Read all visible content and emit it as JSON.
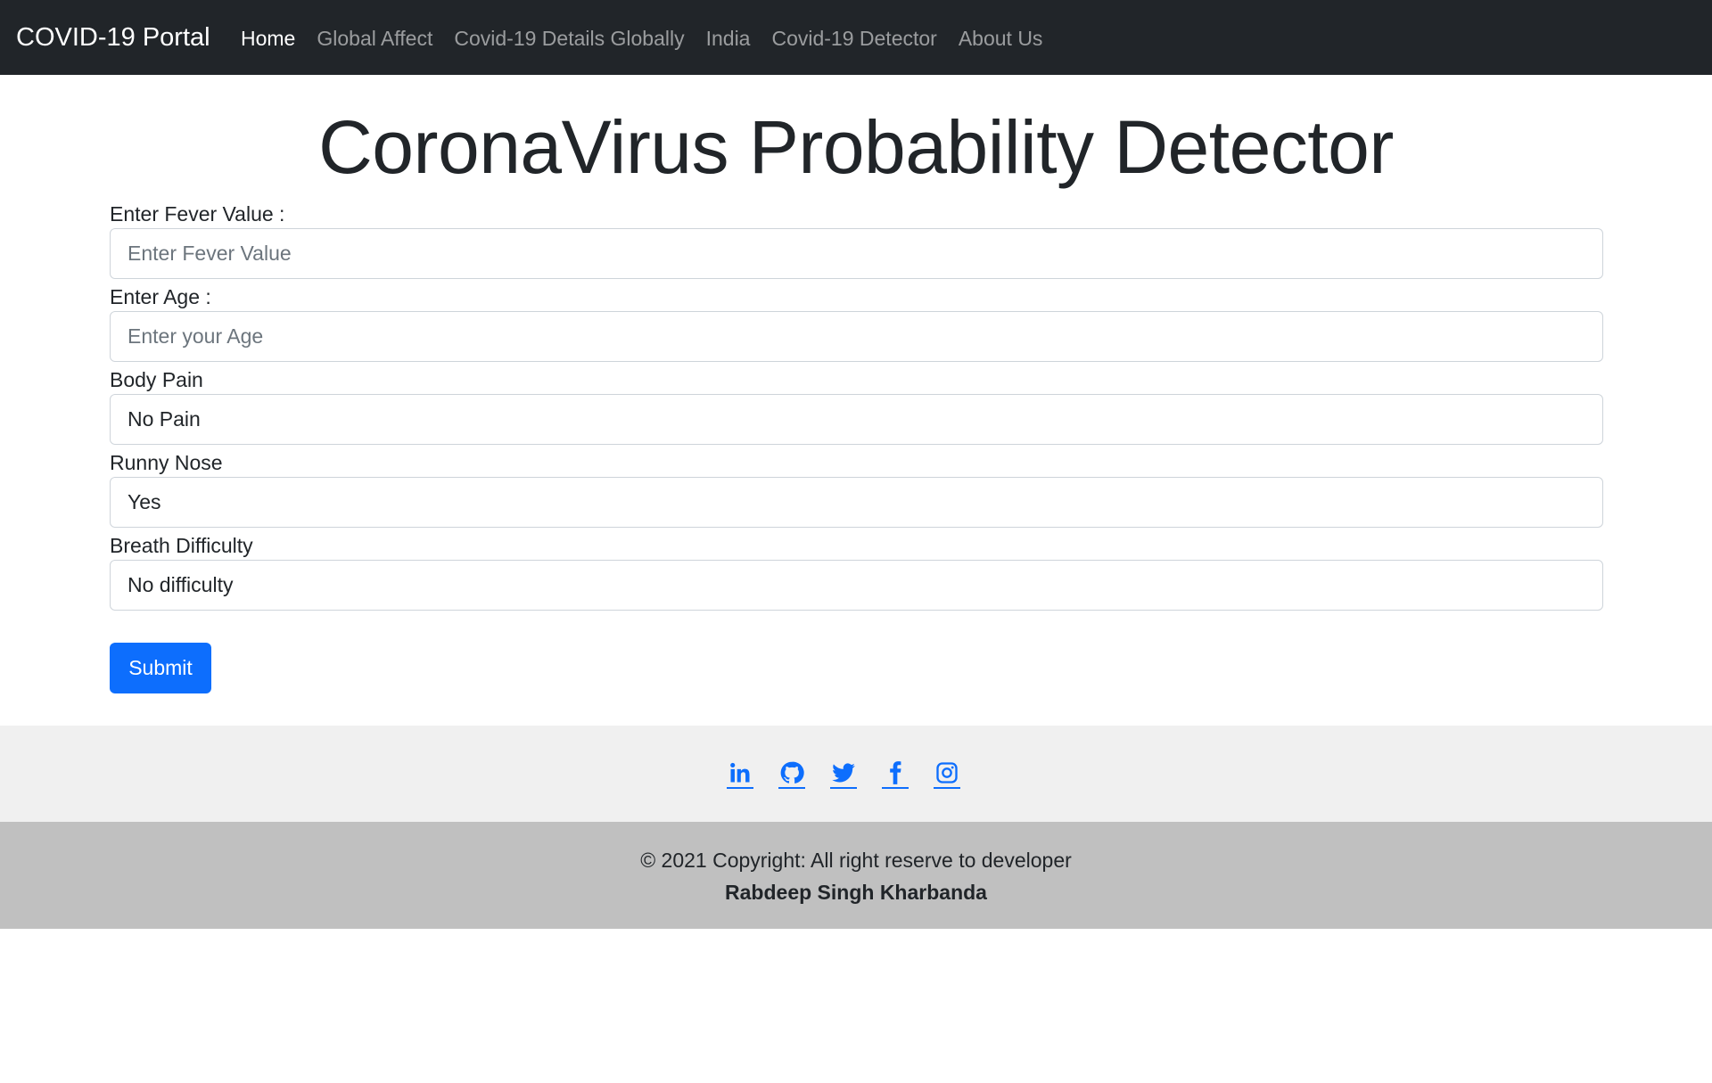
{
  "navbar": {
    "brand": "COVID-19 Portal",
    "links": [
      {
        "label": "Home",
        "active": true
      },
      {
        "label": "Global Affect",
        "active": false
      },
      {
        "label": "Covid-19 Details Globally",
        "active": false
      },
      {
        "label": "India",
        "active": false
      },
      {
        "label": "Covid-19 Detector",
        "active": false
      },
      {
        "label": "About Us",
        "active": false
      }
    ]
  },
  "page_title": "CoronaVirus Probability Detector",
  "form": {
    "fever": {
      "label": "Enter Fever Value :",
      "placeholder": "Enter Fever Value",
      "value": ""
    },
    "age": {
      "label": "Enter Age :",
      "placeholder": "Enter your Age",
      "value": ""
    },
    "body_pain": {
      "label": "Body Pain",
      "selected": "No Pain"
    },
    "runny_nose": {
      "label": "Runny Nose",
      "selected": "Yes"
    },
    "breath_difficulty": {
      "label": "Breath Difficulty",
      "selected": "No difficulty"
    },
    "submit_label": "Submit"
  },
  "social": {
    "icons": [
      "linkedin-icon",
      "github-icon",
      "twitter-icon",
      "facebook-icon",
      "instagram-icon"
    ]
  },
  "footer": {
    "copyright": "© 2021 Copyright: All right reserve to developer",
    "developer": "Rabdeep Singh Kharbanda"
  },
  "colors": {
    "navbar_bg": "#212529",
    "primary": "#0d6efd",
    "social_bg": "#f0f0f0",
    "footer_bg": "#c0c0c0"
  }
}
